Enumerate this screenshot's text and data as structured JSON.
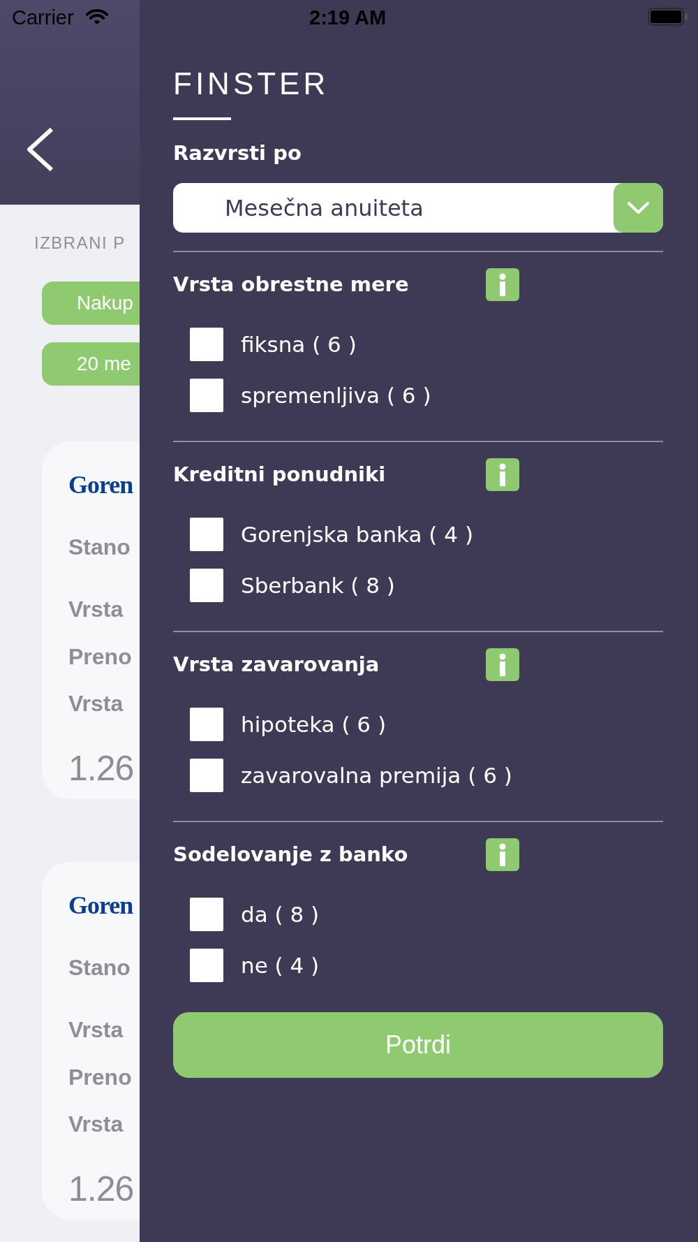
{
  "status_bar": {
    "carrier": "Carrier",
    "time": "2:19 AM"
  },
  "background_screen": {
    "section_label": "IZBRANI P",
    "chips": [
      "Nakup",
      "20 me"
    ],
    "cards": [
      {
        "logo_text": "Goren",
        "product": "Stano",
        "details": [
          "Vrsta",
          "Preno",
          "Vrsta"
        ],
        "amount": "1.26"
      },
      {
        "logo_text": "Goren",
        "product": "Stano",
        "details": [
          "Vrsta",
          "Preno",
          "Vrsta"
        ],
        "amount": "1.26"
      }
    ]
  },
  "drawer": {
    "brand": "FINSTER",
    "sort": {
      "label": "Razvrsti po",
      "value": "Mesečna anuiteta"
    },
    "filter_groups": [
      {
        "title": "Vrsta obrestne mere",
        "options": [
          {
            "label": "fiksna ( 6 )",
            "checked": false
          },
          {
            "label": "spremenljiva ( 6 )",
            "checked": false
          }
        ]
      },
      {
        "title": "Kreditni ponudniki",
        "options": [
          {
            "label": "Gorenjska banka ( 4 )",
            "checked": false
          },
          {
            "label": "Sberbank ( 8 )",
            "checked": false
          }
        ]
      },
      {
        "title": "Vrsta zavarovanja",
        "options": [
          {
            "label": "hipoteka ( 6 )",
            "checked": false
          },
          {
            "label": "zavarovalna premija ( 6 )",
            "checked": false
          }
        ]
      },
      {
        "title": "Sodelovanje z banko",
        "options": [
          {
            "label": "da ( 8 )",
            "checked": false
          },
          {
            "label": "ne ( 4 )",
            "checked": false
          }
        ]
      }
    ],
    "confirm_button": "Potrdi"
  }
}
